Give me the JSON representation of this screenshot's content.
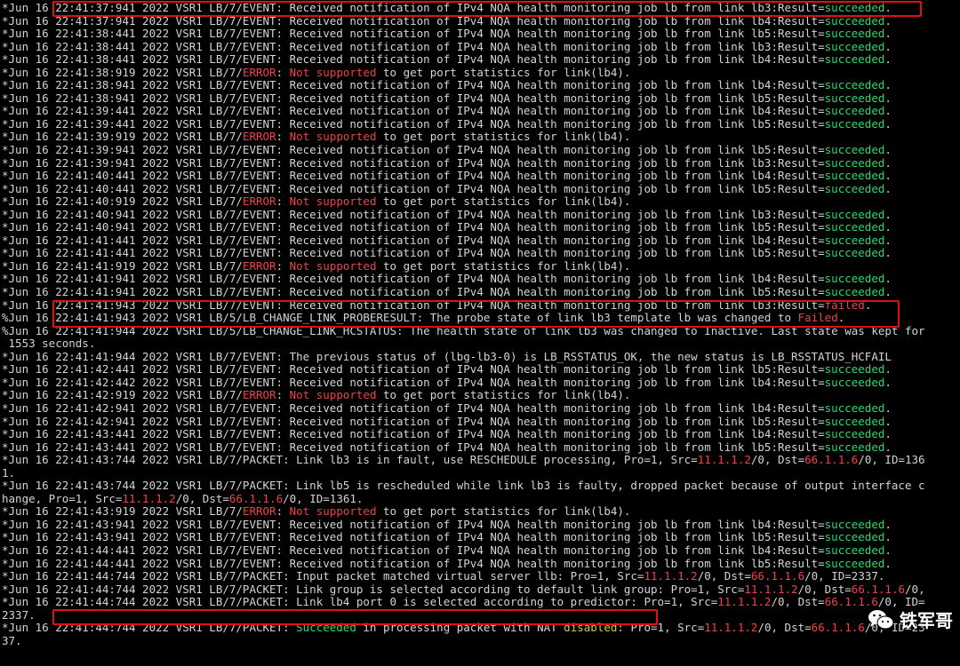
{
  "colors": {
    "background": "#000000",
    "text": "#d4d4d4",
    "success": "#2bd96a",
    "error": "#ee4444",
    "warning": "#cfc93a",
    "highlight_box": "#e01010"
  },
  "watermark": {
    "icon": "wechat-icon",
    "text": "铁军哥"
  },
  "lines": [
    [
      {
        "t": "*Jun 16 22:41:37:941 2022 VSR1 LB/7/EVENT: Received notification of IPv4 NQA health monitoring job lb from link lb3:Result="
      },
      {
        "t": "succeeded",
        "c": "green"
      },
      {
        "t": "."
      }
    ],
    [
      {
        "t": "*Jun 16 22:41:37:941 2022 VSR1 LB/7/EVENT: Received notification of IPv4 NQA health monitoring job lb from link lb4:Result="
      },
      {
        "t": "succeeded",
        "c": "green"
      },
      {
        "t": "."
      }
    ],
    [
      {
        "t": "*Jun 16 22:41:38:441 2022 VSR1 LB/7/EVENT: Received notification of IPv4 NQA health monitoring job lb from link lb5:Result="
      },
      {
        "t": "succeeded",
        "c": "green"
      },
      {
        "t": "."
      }
    ],
    [
      {
        "t": "*Jun 16 22:41:38:441 2022 VSR1 LB/7/EVENT: Received notification of IPv4 NQA health monitoring job lb from link lb3:Result="
      },
      {
        "t": "succeeded",
        "c": "green"
      },
      {
        "t": "."
      }
    ],
    [
      {
        "t": "*Jun 16 22:41:38:441 2022 VSR1 LB/7/EVENT: Received notification of IPv4 NQA health monitoring job lb from link lb4:Result="
      },
      {
        "t": "succeeded",
        "c": "green"
      },
      {
        "t": "."
      }
    ],
    [
      {
        "t": "*Jun 16 22:41:38:919 2022 VSR1 LB/7/"
      },
      {
        "t": "ERROR",
        "c": "red"
      },
      {
        "t": ": "
      },
      {
        "t": "Not supported",
        "c": "red"
      },
      {
        "t": " to get port statistics for link(lb4)."
      }
    ],
    [
      {
        "t": "*Jun 16 22:41:38:941 2022 VSR1 LB/7/EVENT: Received notification of IPv4 NQA health monitoring job lb from link lb4:Result="
      },
      {
        "t": "succeeded",
        "c": "green"
      },
      {
        "t": "."
      }
    ],
    [
      {
        "t": "*Jun 16 22:41:38:941 2022 VSR1 LB/7/EVENT: Received notification of IPv4 NQA health monitoring job lb from link lb5:Result="
      },
      {
        "t": "succeeded",
        "c": "green"
      },
      {
        "t": "."
      }
    ],
    [
      {
        "t": "*Jun 16 22:41:39:441 2022 VSR1 LB/7/EVENT: Received notification of IPv4 NQA health monitoring job lb from link lb4:Result="
      },
      {
        "t": "succeeded",
        "c": "green"
      },
      {
        "t": "."
      }
    ],
    [
      {
        "t": "*Jun 16 22:41:39:441 2022 VSR1 LB/7/EVENT: Received notification of IPv4 NQA health monitoring job lb from link lb5:Result="
      },
      {
        "t": "succeeded",
        "c": "green"
      },
      {
        "t": "."
      }
    ],
    [
      {
        "t": "*Jun 16 22:41:39:919 2022 VSR1 LB/7/"
      },
      {
        "t": "ERROR",
        "c": "red"
      },
      {
        "t": ": "
      },
      {
        "t": "Not supported",
        "c": "red"
      },
      {
        "t": " to get port statistics for link(lb4)."
      }
    ],
    [
      {
        "t": "*Jun 16 22:41:39:941 2022 VSR1 LB/7/EVENT: Received notification of IPv4 NQA health monitoring job lb from link lb5:Result="
      },
      {
        "t": "succeeded",
        "c": "green"
      },
      {
        "t": "."
      }
    ],
    [
      {
        "t": "*Jun 16 22:41:39:941 2022 VSR1 LB/7/EVENT: Received notification of IPv4 NQA health monitoring job lb from link lb3:Result="
      },
      {
        "t": "succeeded",
        "c": "green"
      },
      {
        "t": "."
      }
    ],
    [
      {
        "t": "*Jun 16 22:41:40:441 2022 VSR1 LB/7/EVENT: Received notification of IPv4 NQA health monitoring job lb from link lb4:Result="
      },
      {
        "t": "succeeded",
        "c": "green"
      },
      {
        "t": "."
      }
    ],
    [
      {
        "t": "*Jun 16 22:41:40:441 2022 VSR1 LB/7/EVENT: Received notification of IPv4 NQA health monitoring job lb from link lb5:Result="
      },
      {
        "t": "succeeded",
        "c": "green"
      },
      {
        "t": "."
      }
    ],
    [
      {
        "t": "*Jun 16 22:41:40:919 2022 VSR1 LB/7/"
      },
      {
        "t": "ERROR",
        "c": "red"
      },
      {
        "t": ": "
      },
      {
        "t": "Not supported",
        "c": "red"
      },
      {
        "t": " to get port statistics for link(lb4)."
      }
    ],
    [
      {
        "t": "*Jun 16 22:41:40:941 2022 VSR1 LB/7/EVENT: Received notification of IPv4 NQA health monitoring job lb from link lb3:Result="
      },
      {
        "t": "succeeded",
        "c": "green"
      },
      {
        "t": "."
      }
    ],
    [
      {
        "t": "*Jun 16 22:41:40:941 2022 VSR1 LB/7/EVENT: Received notification of IPv4 NQA health monitoring job lb from link lb5:Result="
      },
      {
        "t": "succeeded",
        "c": "green"
      },
      {
        "t": "."
      }
    ],
    [
      {
        "t": "*Jun 16 22:41:41:441 2022 VSR1 LB/7/EVENT: Received notification of IPv4 NQA health monitoring job lb from link lb4:Result="
      },
      {
        "t": "succeeded",
        "c": "green"
      },
      {
        "t": "."
      }
    ],
    [
      {
        "t": "*Jun 16 22:41:41:441 2022 VSR1 LB/7/EVENT: Received notification of IPv4 NQA health monitoring job lb from link lb5:Result="
      },
      {
        "t": "succeeded",
        "c": "green"
      },
      {
        "t": "."
      }
    ],
    [
      {
        "t": "*Jun 16 22:41:41:919 2022 VSR1 LB/7/"
      },
      {
        "t": "ERROR",
        "c": "red"
      },
      {
        "t": ": "
      },
      {
        "t": "Not supported",
        "c": "red"
      },
      {
        "t": " to get port statistics for link(lb4)."
      }
    ],
    [
      {
        "t": "*Jun 16 22:41:41:941 2022 VSR1 LB/7/EVENT: Received notification of IPv4 NQA health monitoring job lb from link lb4:Result="
      },
      {
        "t": "succeeded",
        "c": "green"
      },
      {
        "t": "."
      }
    ],
    [
      {
        "t": "*Jun 16 22:41:41:941 2022 VSR1 LB/7/EVENT: Received notification of IPv4 NQA health monitoring job lb from link lb5:Result="
      },
      {
        "t": "succeeded",
        "c": "green"
      },
      {
        "t": "."
      }
    ],
    [
      {
        "t": "*Jun 16 22:41:41:943 2022 VSR1 LB/7/EVENT: Received notification of IPv4 NQA health monitoring job lb from link lb3:Result="
      },
      {
        "t": "failed",
        "c": "red"
      },
      {
        "t": "."
      }
    ],
    [
      {
        "t": "%Jun 16 22:41:41:943 2022 VSR1 LB/5/LB_CHANGE_LINK_PROBERESULT: The probe state of link lb3 template lb was changed to "
      },
      {
        "t": "Failed",
        "c": "red"
      },
      {
        "t": "."
      }
    ],
    [
      {
        "t": "%Jun 16 22:41:41:944 2022 VSR1 LB/5/LB_CHANGE_LINK_HCSTATUS: The health state of link lb3 was changed to Inactive. Last state was kept for"
      }
    ],
    [
      {
        "t": " 1553 seconds."
      }
    ],
    [
      {
        "t": "*Jun 16 22:41:41:944 2022 VSR1 LB/7/EVENT: The previous status of (lbg-lb3-0) is LB_RSSTATUS_OK, the new status is LB_RSSTATUS_HCFAIL"
      }
    ],
    [
      {
        "t": "*Jun 16 22:41:42:441 2022 VSR1 LB/7/EVENT: Received notification of IPv4 NQA health monitoring job lb from link lb5:Result="
      },
      {
        "t": "succeeded",
        "c": "green"
      },
      {
        "t": "."
      }
    ],
    [
      {
        "t": "*Jun 16 22:41:42:442 2022 VSR1 LB/7/EVENT: Received notification of IPv4 NQA health monitoring job lb from link lb4:Result="
      },
      {
        "t": "succeeded",
        "c": "green"
      },
      {
        "t": "."
      }
    ],
    [
      {
        "t": "*Jun 16 22:41:42:919 2022 VSR1 LB/7/"
      },
      {
        "t": "ERROR",
        "c": "red"
      },
      {
        "t": ": "
      },
      {
        "t": "Not supported",
        "c": "red"
      },
      {
        "t": " to get port statistics for link(lb4)."
      }
    ],
    [
      {
        "t": "*Jun 16 22:41:42:941 2022 VSR1 LB/7/EVENT: Received notification of IPv4 NQA health monitoring job lb from link lb4:Result="
      },
      {
        "t": "succeeded",
        "c": "green"
      },
      {
        "t": "."
      }
    ],
    [
      {
        "t": "*Jun 16 22:41:42:941 2022 VSR1 LB/7/EVENT: Received notification of IPv4 NQA health monitoring job lb from link lb5:Result="
      },
      {
        "t": "succeeded",
        "c": "green"
      },
      {
        "t": "."
      }
    ],
    [
      {
        "t": "*Jun 16 22:41:43:441 2022 VSR1 LB/7/EVENT: Received notification of IPv4 NQA health monitoring job lb from link lb4:Result="
      },
      {
        "t": "succeeded",
        "c": "green"
      },
      {
        "t": "."
      }
    ],
    [
      {
        "t": "*Jun 16 22:41:43:441 2022 VSR1 LB/7/EVENT: Received notification of IPv4 NQA health monitoring job lb from link lb5:Result="
      },
      {
        "t": "succeeded",
        "c": "green"
      },
      {
        "t": "."
      }
    ],
    [
      {
        "t": "*Jun 16 22:41:43:744 2022 VSR1 LB/7/PACKET: Link lb3 is in fault, use RESCHEDULE processing, Pro=1, Src="
      },
      {
        "t": "11.1.1.2",
        "c": "red"
      },
      {
        "t": "/0, Dst="
      },
      {
        "t": "66.1.1.6",
        "c": "red"
      },
      {
        "t": "/0, ID=136"
      }
    ],
    [
      {
        "t": "1."
      }
    ],
    [
      {
        "t": "*Jun 16 22:41:43:744 2022 VSR1 LB/7/PACKET: Link lb5 is rescheduled while link lb3 is faulty, dropped packet because of output interface c"
      }
    ],
    [
      {
        "t": "hange, Pro=1, Src="
      },
      {
        "t": "11.1.1.2",
        "c": "red"
      },
      {
        "t": "/0, Dst="
      },
      {
        "t": "66.1.1.6",
        "c": "red"
      },
      {
        "t": "/0, ID=1361."
      }
    ],
    [
      {
        "t": "*Jun 16 22:41:43:919 2022 VSR1 LB/7/"
      },
      {
        "t": "ERROR",
        "c": "red"
      },
      {
        "t": ": "
      },
      {
        "t": "Not supported",
        "c": "red"
      },
      {
        "t": " to get port statistics for link(lb4)."
      }
    ],
    [
      {
        "t": "*Jun 16 22:41:43:941 2022 VSR1 LB/7/EVENT: Received notification of IPv4 NQA health monitoring job lb from link lb4:Result="
      },
      {
        "t": "succeeded",
        "c": "green"
      },
      {
        "t": "."
      }
    ],
    [
      {
        "t": "*Jun 16 22:41:43:941 2022 VSR1 LB/7/EVENT: Received notification of IPv4 NQA health monitoring job lb from link lb5:Result="
      },
      {
        "t": "succeeded",
        "c": "green"
      },
      {
        "t": "."
      }
    ],
    [
      {
        "t": "*Jun 16 22:41:44:441 2022 VSR1 LB/7/EVENT: Received notification of IPv4 NQA health monitoring job lb from link lb4:Result="
      },
      {
        "t": "succeeded",
        "c": "green"
      },
      {
        "t": "."
      }
    ],
    [
      {
        "t": "*Jun 16 22:41:44:441 2022 VSR1 LB/7/EVENT: Received notification of IPv4 NQA health monitoring job lb from link lb5:Result="
      },
      {
        "t": "succeeded",
        "c": "green"
      },
      {
        "t": "."
      }
    ],
    [
      {
        "t": "*Jun 16 22:41:44:744 2022 VSR1 LB/7/PACKET: Input packet matched virtual server llb: Pro=1, Src="
      },
      {
        "t": "11.1.1.2",
        "c": "red"
      },
      {
        "t": "/0, Dst="
      },
      {
        "t": "66.1.1.6",
        "c": "red"
      },
      {
        "t": "/0, ID=2337."
      }
    ],
    [
      {
        "t": "*Jun 16 22:41:44:744 2022 VSR1 LB/7/PACKET: Link group is selected according to default link group: Pro=1, Src="
      },
      {
        "t": "11.1.1.2",
        "c": "red"
      },
      {
        "t": "/0, Dst="
      },
      {
        "t": "66.1.1.6",
        "c": "red"
      },
      {
        "t": "/0,"
      }
    ],
    [
      {
        "t": "*Jun 16 22:41:44:744 2022 VSR1 LB/7/PACKET: Link lb4 port 0 is selected according to predictor: Pro=1, Src="
      },
      {
        "t": "11.1.1.2",
        "c": "red"
      },
      {
        "t": "/0, Dst="
      },
      {
        "t": "66.1.1.6",
        "c": "red"
      },
      {
        "t": "/0, ID="
      }
    ],
    [
      {
        "t": "2337."
      }
    ],
    [
      {
        "t": "*Jun 16 22:41:44:744 2022 VSR1 LB/7/PACKET: "
      },
      {
        "t": "Succeeded",
        "c": "green"
      },
      {
        "t": " in processing packet with NAT "
      },
      {
        "t": "disabled",
        "c": "yellow"
      },
      {
        "t": ": Pro=1, Src="
      },
      {
        "t": "11.1.1.2",
        "c": "red"
      },
      {
        "t": "/0, Dst="
      },
      {
        "t": "66.1.1.6",
        "c": "red"
      },
      {
        "t": "/0, ID=23"
      }
    ],
    [
      {
        "t": "37."
      }
    ]
  ]
}
